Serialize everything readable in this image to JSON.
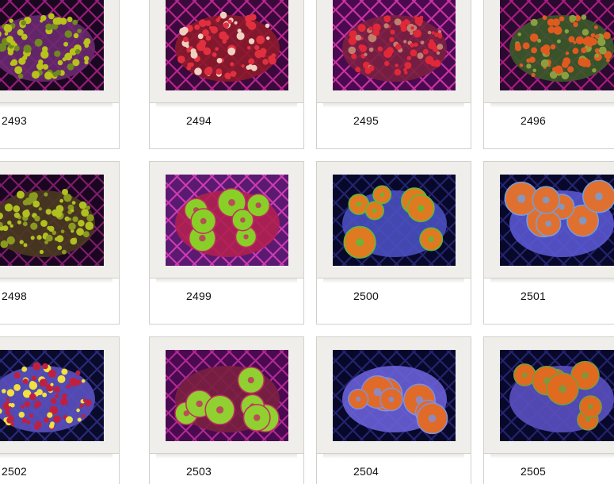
{
  "items": [
    {
      "id": "2493",
      "palette": {
        "bg": "#1a0820",
        "grid": "#b0208c",
        "rock": "#6a2a70",
        "polyp": "#b8c21a",
        "accent": "#6f8a1e"
      },
      "style": "green-mat"
    },
    {
      "id": "2494",
      "palette": {
        "bg": "#3a0a3c",
        "grid": "#d02a9c",
        "rock": "#8c1a2a",
        "polyp": "#e03040",
        "accent": "#f0d0c0"
      },
      "style": "red-mat"
    },
    {
      "id": "2495",
      "palette": {
        "bg": "#4a0a50",
        "grid": "#e03ab0",
        "rock": "#7a2040",
        "polyp": "#e02838",
        "accent": "#c08070"
      },
      "style": "red-mat"
    },
    {
      "id": "2496",
      "palette": {
        "bg": "#2a0a30",
        "grid": "#c0208c",
        "rock": "#3a5a2a",
        "polyp": "#e05a20",
        "accent": "#8aa040"
      },
      "style": "orange-mat"
    },
    {
      "id": "2498",
      "palette": {
        "bg": "#1a0620",
        "grid": "#902078",
        "rock": "#4a3a20",
        "polyp": "#b0c020",
        "accent": "#8a9a20"
      },
      "style": "green-mat"
    },
    {
      "id": "2499",
      "palette": {
        "bg": "#5a1a70",
        "grid": "#e040c0",
        "rock": "#b02050",
        "polyp": "#88d028",
        "accent": "#c03060"
      },
      "style": "green-discs"
    },
    {
      "id": "2500",
      "palette": {
        "bg": "#08082a",
        "grid": "#2a2a7a",
        "rock": "#4a50c0",
        "polyp": "#e07a20",
        "accent": "#50c040"
      },
      "style": "orange-discs"
    },
    {
      "id": "2501",
      "palette": {
        "bg": "#08082a",
        "grid": "#2a2a7a",
        "rock": "#5a58d0",
        "polyp": "#e07030",
        "accent": "#70a0e0"
      },
      "style": "orange-discs"
    },
    {
      "id": "2502",
      "palette": {
        "bg": "#0a0a2a",
        "grid": "#30308a",
        "rock": "#5a50c0",
        "polyp": "#c02040",
        "accent": "#f0e040"
      },
      "style": "red-mat"
    },
    {
      "id": "2503",
      "palette": {
        "bg": "#4a0a50",
        "grid": "#c030a0",
        "rock": "#7a2040",
        "polyp": "#90d030",
        "accent": "#c03060"
      },
      "style": "green-discs"
    },
    {
      "id": "2504",
      "palette": {
        "bg": "#08082a",
        "grid": "#2a2a7a",
        "rock": "#6a60d8",
        "polyp": "#e06a28",
        "accent": "#8090e0"
      },
      "style": "orange-discs"
    },
    {
      "id": "2505",
      "palette": {
        "bg": "#08082a",
        "grid": "#2a2a7a",
        "rock": "#5a50c0",
        "polyp": "#e06a20",
        "accent": "#70a040"
      },
      "style": "orange-discs"
    }
  ]
}
